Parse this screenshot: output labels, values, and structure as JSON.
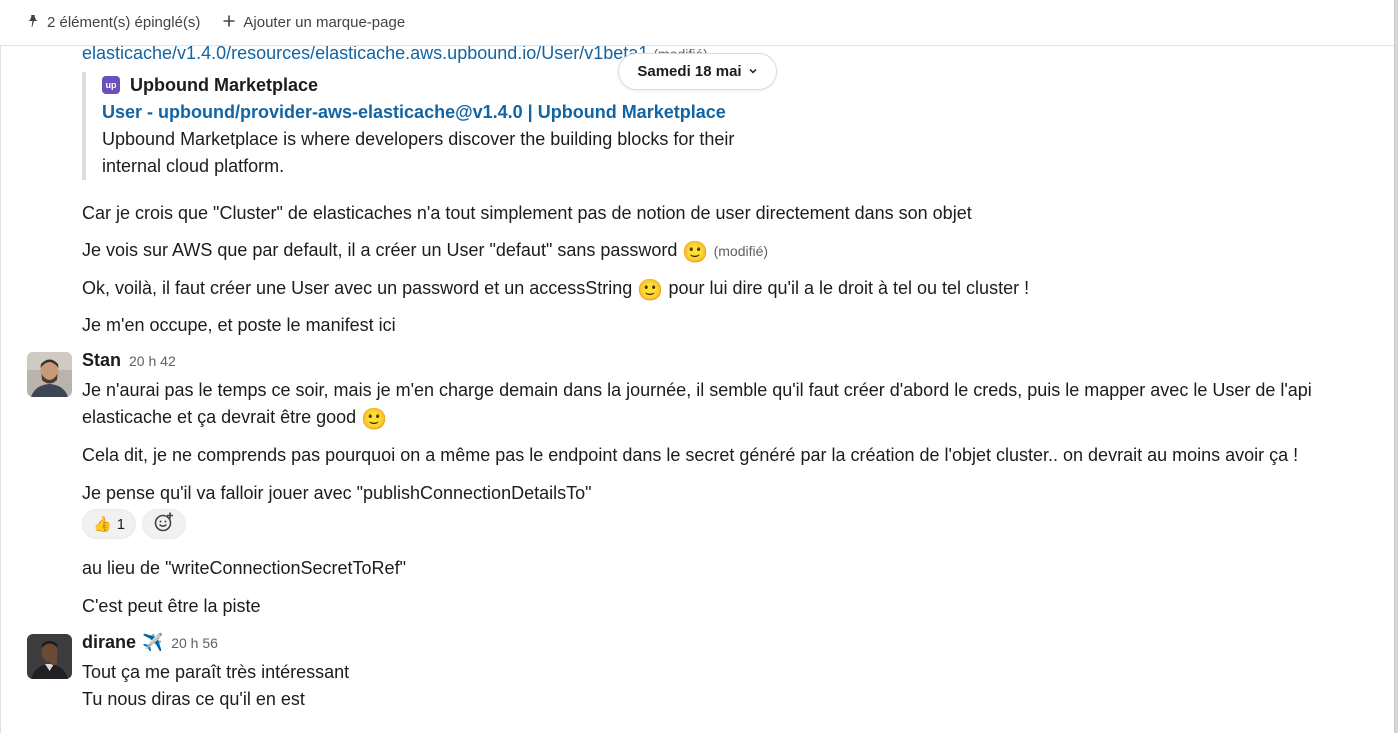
{
  "bookmarks": {
    "pinned_label": "2 élément(s) épinglé(s)",
    "add_label": "Ajouter un marque-page"
  },
  "date_divider": "Samedi 18 mai",
  "prev_message": {
    "link_text": "elasticache/v1.4.0/resources/elasticache.aws.upbound.io/User/v1beta1",
    "link_edited": "(modifié)",
    "unfurl": {
      "site_name": "Upbound Marketplace",
      "logo_text": "up",
      "title": "User - upbound/provider-aws-elasticache@v1.4.0 | Upbound Marketplace",
      "description": "Upbound Marketplace is where developers discover the building blocks for their internal cloud platform."
    },
    "lines": [
      "Car je crois que \"Cluster\" de elasticaches n'a tout simplement pas de notion de user directement dans son objet",
      "Je vois sur AWS que par default, il a créer un User \"defaut\" sans password",
      "Ok, voilà, il faut créer une User avec un password et un accessString",
      " pour lui dire qu'il a le droit à tel ou tel cluster !",
      "Je m'en occupe, et poste le manifest ici"
    ],
    "edited_label": "(modifié)",
    "smile": "🙂"
  },
  "stan": {
    "author": "Stan",
    "time": "20 h 42",
    "lines": [
      "Je n'aurai pas le temps ce soir, mais je m'en charge demain dans la journée, il semble qu'il faut créer d'abord le creds, puis le mapper avec le User de l'api",
      "elasticache et ça devrait être good",
      "Cela dit, je ne comprends pas pourquoi on a même pas le endpoint dans le secret généré par la création de l'objet cluster.. on devrait au moins avoir ça !",
      "Je pense qu'il va falloir jouer avec \"publishConnectionDetailsTo\"",
      "au lieu de \"writeConnectionSecretToRef\"",
      "C'est peut être la piste"
    ],
    "reaction": {
      "emoji": "👍",
      "count": "1"
    }
  },
  "dirane": {
    "author": "dirane",
    "status_emoji": "✈️",
    "time": "20 h 56",
    "lines": [
      "Tout ça me paraît très intéressant",
      "Tu nous diras ce qu'il en est"
    ]
  }
}
